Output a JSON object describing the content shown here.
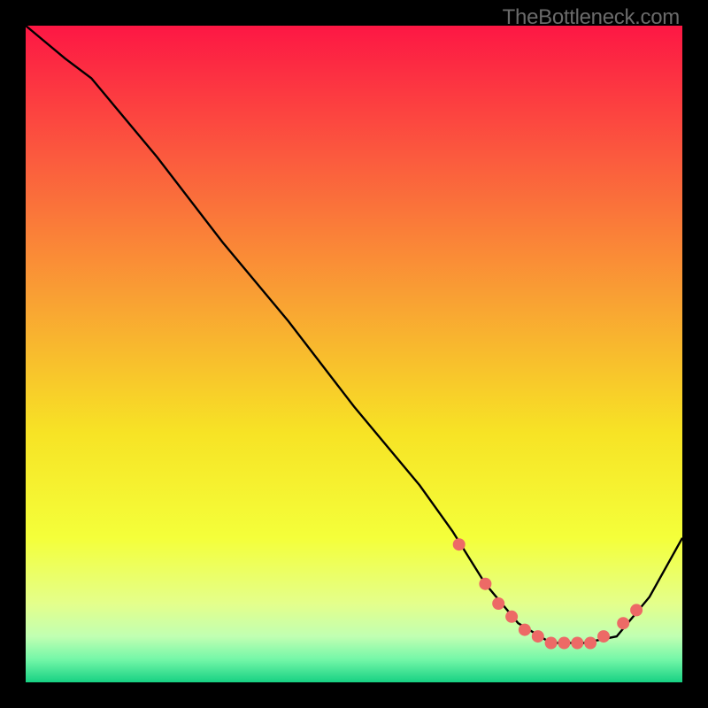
{
  "watermark": "TheBottleneck.com",
  "chart_data": {
    "type": "line",
    "title": "",
    "xlabel": "",
    "ylabel": "",
    "xlim": [
      0,
      100
    ],
    "ylim": [
      0,
      100
    ],
    "series": [
      {
        "name": "curve",
        "x": [
          0,
          6,
          10,
          20,
          30,
          40,
          50,
          60,
          65,
          70,
          75,
          80,
          85,
          90,
          95,
          100
        ],
        "y": [
          100,
          95,
          92,
          80,
          67,
          55,
          42,
          30,
          23,
          15,
          9,
          6,
          6,
          7,
          13,
          22
        ]
      }
    ],
    "markers": {
      "name": "dot-cluster",
      "color": "#ed6a66",
      "points": [
        {
          "x": 66,
          "y": 21
        },
        {
          "x": 70,
          "y": 15
        },
        {
          "x": 72,
          "y": 12
        },
        {
          "x": 74,
          "y": 10
        },
        {
          "x": 76,
          "y": 8
        },
        {
          "x": 78,
          "y": 7
        },
        {
          "x": 80,
          "y": 6
        },
        {
          "x": 82,
          "y": 6
        },
        {
          "x": 84,
          "y": 6
        },
        {
          "x": 86,
          "y": 6
        },
        {
          "x": 88,
          "y": 7
        },
        {
          "x": 91,
          "y": 9
        },
        {
          "x": 93,
          "y": 11
        }
      ]
    },
    "background_gradient": {
      "stops": [
        {
          "offset": 0.0,
          "color": "#fd1744"
        },
        {
          "offset": 0.2,
          "color": "#fb5a3e"
        },
        {
          "offset": 0.42,
          "color": "#f9a233"
        },
        {
          "offset": 0.62,
          "color": "#f7e325"
        },
        {
          "offset": 0.78,
          "color": "#f4ff3a"
        },
        {
          "offset": 0.88,
          "color": "#e4ff8b"
        },
        {
          "offset": 0.93,
          "color": "#c1ffb2"
        },
        {
          "offset": 0.965,
          "color": "#74f7a8"
        },
        {
          "offset": 1.0,
          "color": "#17d183"
        }
      ]
    }
  }
}
